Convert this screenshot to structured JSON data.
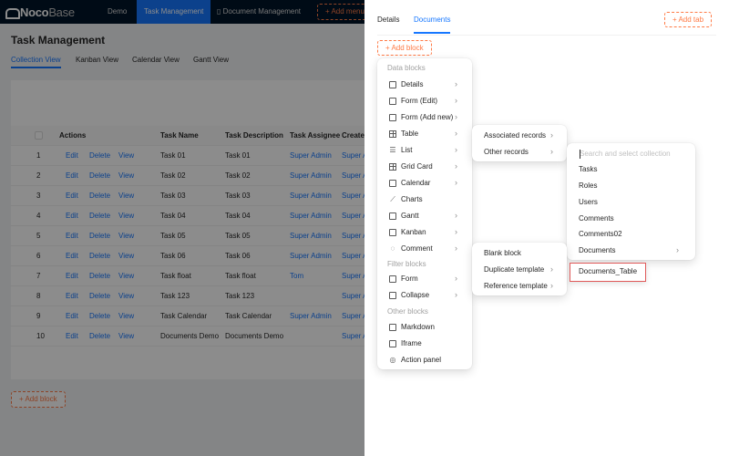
{
  "topbar": {
    "logo_strong": "Noco",
    "logo_light": "Base",
    "nav": [
      "Demo",
      "Task Management",
      "Document Management"
    ],
    "add_menu": "+ Add menu"
  },
  "page": {
    "title": "Task Management",
    "view_tabs": [
      "Collection View",
      "Kanban View",
      "Calendar View",
      "Gantt View"
    ],
    "table": {
      "columns": [
        "Actions",
        "Task Name",
        "Task Description",
        "Task Assignee",
        "Created"
      ],
      "action_labels": [
        "Edit",
        "Delete",
        "View"
      ],
      "rows": [
        {
          "n": "1",
          "name": "Task 01",
          "desc": "Task 01",
          "assignee": "Super Admin",
          "created": "Super A"
        },
        {
          "n": "2",
          "name": "Task 02",
          "desc": "Task 02",
          "assignee": "Super Admin",
          "created": "Super A"
        },
        {
          "n": "3",
          "name": "Task 03",
          "desc": "Task 03",
          "assignee": "Super Admin",
          "created": "Super A"
        },
        {
          "n": "4",
          "name": "Task 04",
          "desc": "Task 04",
          "assignee": "Super Admin",
          "created": "Super A"
        },
        {
          "n": "5",
          "name": "Task 05",
          "desc": "Task 05",
          "assignee": "Super Admin",
          "created": "Super A"
        },
        {
          "n": "6",
          "name": "Task 06",
          "desc": "Task 06",
          "assignee": "Super Admin",
          "created": "Super A"
        },
        {
          "n": "7",
          "name": "Task float",
          "desc": "Task float",
          "assignee": "Tom",
          "created": "Super A"
        },
        {
          "n": "8",
          "name": "Task 123",
          "desc": "Task 123",
          "assignee": "",
          "created": "Super A"
        },
        {
          "n": "9",
          "name": "Task Calendar",
          "desc": "Task Calendar",
          "assignee": "Super Admin",
          "created": "Super A"
        },
        {
          "n": "10",
          "name": "Documents Demo",
          "desc": "Documents Demo",
          "assignee": "",
          "created": "Super A"
        }
      ]
    },
    "add_block": "Add block"
  },
  "drawer": {
    "tabs": [
      "Details",
      "Documents"
    ],
    "add_tab": "Add tab",
    "add_block": "Add block"
  },
  "block_menu": {
    "group_data": "Data blocks",
    "group_filter": "Filter blocks",
    "group_other": "Other blocks",
    "items": [
      "Details",
      "Form (Edit)",
      "Form (Add new)",
      "Table",
      "List",
      "Grid Card",
      "Calendar",
      "Charts",
      "Gantt",
      "Kanban",
      "Comment"
    ],
    "filter_items": [
      "Form",
      "Collapse"
    ],
    "other_items": [
      "Markdown",
      "Iframe",
      "Action panel"
    ]
  },
  "table_submenu": {
    "items": [
      "Associated records",
      "Other records"
    ]
  },
  "collection_menu": {
    "search_placeholder": "Search and select collection",
    "items": [
      "Tasks",
      "Roles",
      "Users",
      "Comments",
      "Comments02",
      "Documents"
    ]
  },
  "comment_submenu": {
    "items": [
      "Blank block",
      "Duplicate template",
      "Reference template"
    ]
  },
  "template_item": "Documents_Table",
  "colors": {
    "accent": "#1677ff",
    "add_button": "#ff7a45",
    "topbar": "#001529",
    "highlight_border": "#e05a5a"
  }
}
